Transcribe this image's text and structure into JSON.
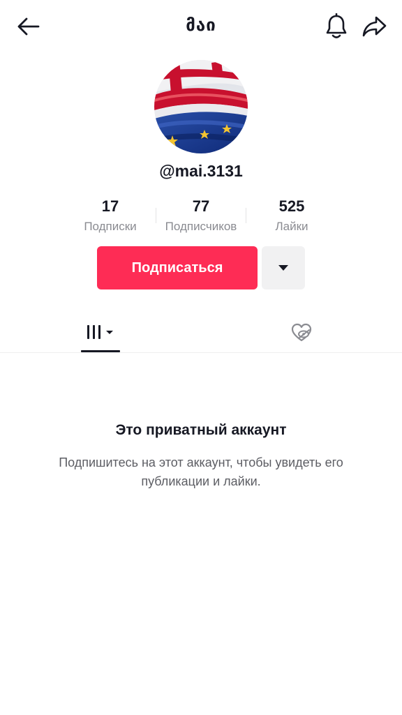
{
  "header": {
    "title": "მაი",
    "back_icon": "back-arrow-icon",
    "bell_icon": "bell-icon",
    "share_icon": "share-icon"
  },
  "profile": {
    "avatar": "georgia-eu-flag-avatar",
    "username": "@mai.3131"
  },
  "stats": [
    {
      "value": "17",
      "label": "Подписки"
    },
    {
      "value": "77",
      "label": "Подписчиков"
    },
    {
      "value": "525",
      "label": "Лайки"
    }
  ],
  "actions": {
    "follow_label": "Подписаться",
    "follow_color": "#fe2c55",
    "more_icon": "caret-down-icon"
  },
  "tabs": {
    "videos_icon": "videos-grid-icon",
    "liked_icon": "hidden-liked-icon"
  },
  "private": {
    "title": "Это приватный аккаунт",
    "description": "Подпишитесь на этот аккаунт, чтобы увидеть его публикации и лайки."
  }
}
